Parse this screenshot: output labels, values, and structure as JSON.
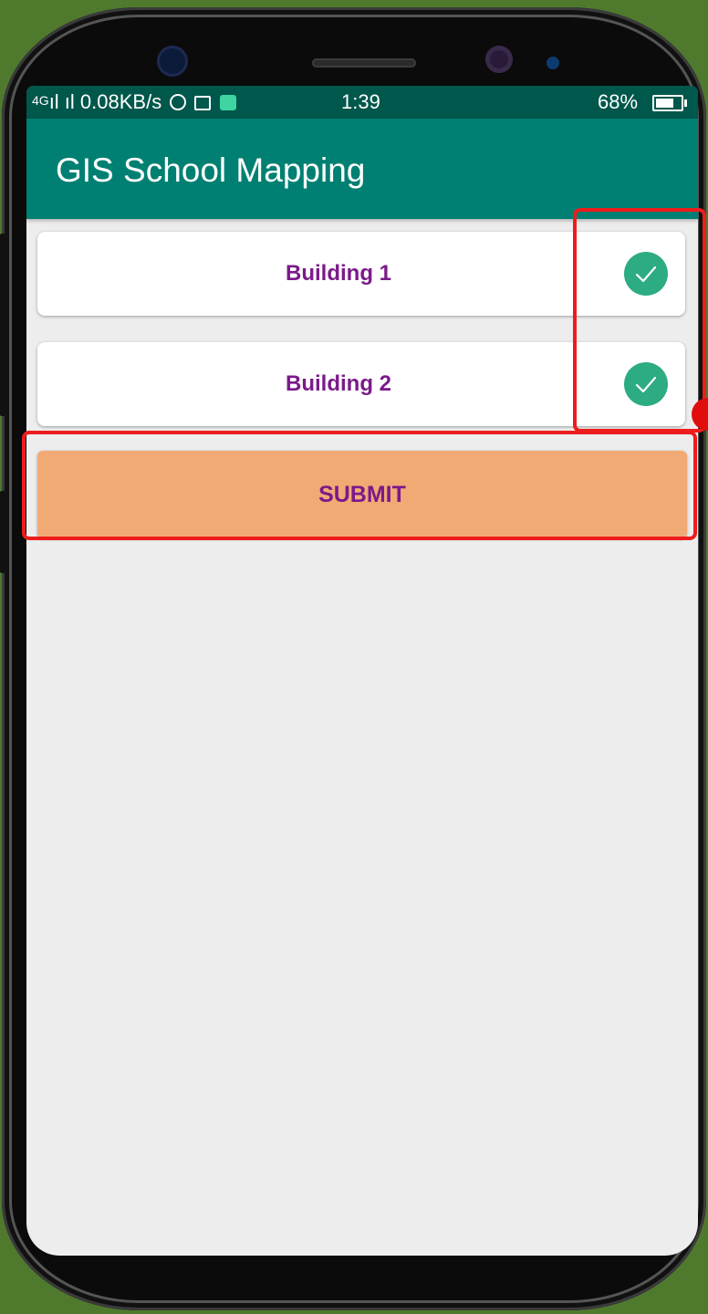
{
  "status_bar": {
    "network_text": "4G",
    "speed_text": "0.08KB/s",
    "time": "1:39",
    "battery_percent": "68%"
  },
  "app_bar": {
    "title": "GIS School Mapping"
  },
  "buildings": [
    {
      "label": "Building 1",
      "checked": true
    },
    {
      "label": "Building 2",
      "checked": true
    }
  ],
  "submit_label": "SUBMIT",
  "icons": {
    "check": "check-circle-icon",
    "signal": "signal-icon",
    "whatsapp": "whatsapp-icon",
    "mail": "mail-icon",
    "battery": "battery-icon"
  },
  "colors": {
    "app_bar": "#008072",
    "status_bar": "#00574b",
    "label": "#7b1a8a",
    "submit_bg": "#f2aa74",
    "check": "#2dab82",
    "highlight": "#ee1c1c"
  }
}
